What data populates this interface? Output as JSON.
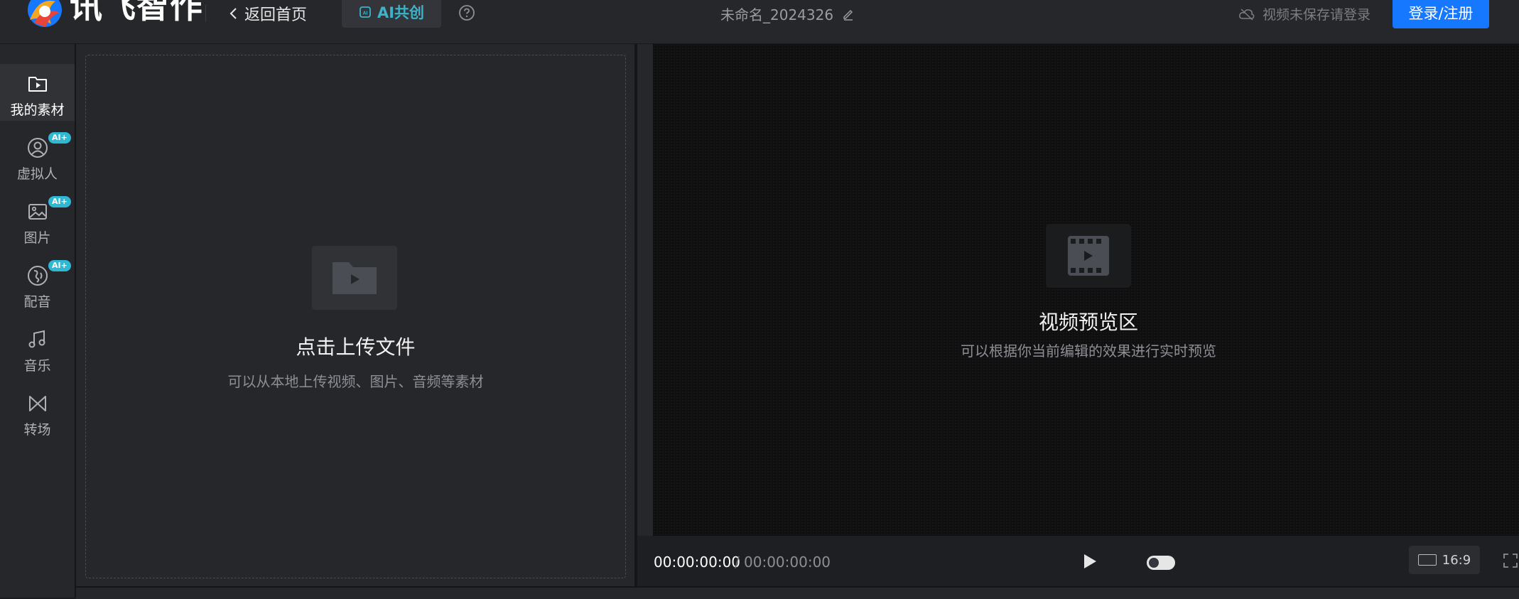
{
  "header": {
    "brand": "讯飞智作",
    "back_label": "返回首页",
    "ai_label": "AI共创",
    "project_name": "未命名_2024326",
    "save_status": "视频未保存请登录",
    "login_label": "登录/注册"
  },
  "sidebar": {
    "items": [
      {
        "label": "我的素材",
        "icon": "media-folder-icon",
        "active": true,
        "badge": ""
      },
      {
        "label": "虚拟人",
        "icon": "avatar-icon",
        "active": false,
        "badge": "AI+"
      },
      {
        "label": "图片",
        "icon": "image-icon",
        "active": false,
        "badge": "AI+"
      },
      {
        "label": "配音",
        "icon": "dubbing-icon",
        "active": false,
        "badge": "AI+"
      },
      {
        "label": "音乐",
        "icon": "music-note-icon",
        "active": false,
        "badge": ""
      },
      {
        "label": "转场",
        "icon": "transition-icon",
        "active": false,
        "badge": ""
      }
    ]
  },
  "upload": {
    "title": "点击上传文件",
    "subtitle": "可以从本地上传视频、图片、音频等素材"
  },
  "preview": {
    "title": "视频预览区",
    "subtitle": "可以根据你当前编辑的效果进行实时预览"
  },
  "player": {
    "current_time": "00:00:00:00",
    "separator": "/",
    "total_time": "00:00:00:00",
    "ratio": "16:9"
  },
  "colors": {
    "accent": "#1677ff",
    "ai_badge": "#2fb8d1",
    "background": "#1b1c1f"
  }
}
